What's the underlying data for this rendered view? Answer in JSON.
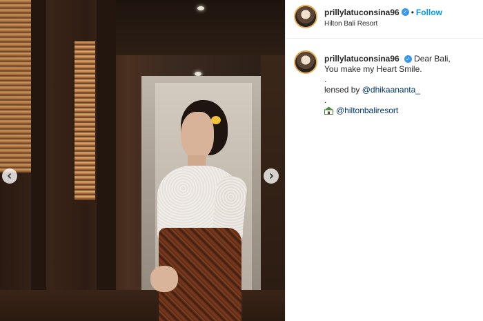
{
  "header": {
    "username": "prillylatuconsina96",
    "separator": "•",
    "follow_label": "Follow",
    "location": "Hilton Bali Resort"
  },
  "caption": {
    "username": "prillylatuconsina96",
    "line1": "Dear Bali,",
    "line2": "You make my Heart Smile.",
    "dot1": ".",
    "lensed_prefix": "lensed by",
    "lensed_mention": "@dhikaananta_",
    "dot2": ".",
    "hotel_mention": "@hiltonbaliresort"
  },
  "media": {
    "prev_icon": "chevron-left-icon",
    "next_icon": "chevron-right-icon"
  },
  "colors": {
    "link": "#0095f6",
    "mention": "#00376b",
    "verified": "#3897f0"
  }
}
